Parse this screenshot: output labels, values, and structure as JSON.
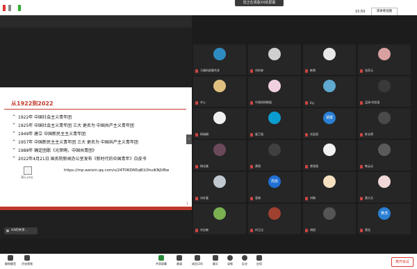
{
  "topbar": {
    "banner": "您正在观看XX的屏幕",
    "time": "15:50",
    "view_button": "演讲者视图"
  },
  "slide": {
    "title": "从1922到2022",
    "lines": [
      "1922年 中国社会主义青年团",
      "1925年 中国社会主义青年团 三大 更名为 中国共产主义青年团",
      "1949年 建立 中国新民主主义青年团",
      "1957年 中国新民主主义青年团 三大 更名为 中国共产主义青年团",
      "1988年 确定团歌《光荣啊，中国共青团》",
      "2022年4月21日 国务院新闻办公室发布《新时代的中国青年》白皮书"
    ],
    "url": "https://mp.weixin.qq.com/s/24T0RDN5qB1OhuiKNJVBw",
    "caption": "演示.png",
    "page": "1"
  },
  "share_label": "XX的共享...",
  "participants": [
    {
      "name": "马晴的屏幕共享",
      "color": "#2e8bc0",
      "text": ""
    },
    {
      "name": "刘怡婷",
      "color": "#cfcfcf",
      "text": ""
    },
    {
      "name": "韩雪",
      "color": "#e8e8e8",
      "text": ""
    },
    {
      "name": "张奇元",
      "color": "#d9a0a0",
      "text": ""
    },
    {
      "name": "齐心",
      "color": "#e0c080",
      "text": ""
    },
    {
      "name": "中国知网数据",
      "color": "#f0d0e0",
      "text": ""
    },
    {
      "name": "Ely",
      "color": "#5fa8d0",
      "text": ""
    },
    {
      "name": "孟绿·刘凯强",
      "color": "#3a3a3a",
      "text": ""
    },
    {
      "name": "杨瑞娟",
      "color": "#f0f0f0",
      "text": ""
    },
    {
      "name": "翟卫强",
      "color": "#0a9dd0",
      "text": ""
    },
    {
      "name": "任延斌",
      "color": "#2a7fd4",
      "text": "胡斌"
    },
    {
      "name": "陈长德",
      "color": "#4a4a4a",
      "text": ""
    },
    {
      "name": "杨佳美",
      "color": "#6a4a5a",
      "text": ""
    },
    {
      "name": "黄翔",
      "color": "#404040",
      "text": ""
    },
    {
      "name": "曾强强",
      "color": "#f2f2f2",
      "text": ""
    },
    {
      "name": "韩云洁",
      "color": "#5a5a5a",
      "text": ""
    },
    {
      "name": "刘轩嘉",
      "color": "#c0c8d0",
      "text": ""
    },
    {
      "name": "葛晓",
      "color": "#1f6fd6",
      "text": "周扬"
    },
    {
      "name": "刘畅",
      "color": "#f5e0c0",
      "text": ""
    },
    {
      "name": "黄大兵",
      "color": "#f0d8d8",
      "text": ""
    },
    {
      "name": "刘志敏",
      "color": "#7ab050",
      "text": ""
    },
    {
      "name": "何玉洁",
      "color": "#a04030",
      "text": ""
    },
    {
      "name": "胡斌",
      "color": "#555555",
      "text": ""
    },
    {
      "name": "黄浩",
      "color": "#2a7fd4",
      "text": "黄浩"
    }
  ],
  "toolbar": {
    "left": [
      "解除静音",
      "开启视频"
    ],
    "center": [
      "共享屏幕",
      "邀请",
      "成员(24)",
      "聊天",
      "录制",
      "反应",
      "应用"
    ],
    "leave": "离开会议"
  },
  "colors": {
    "accent": "#c0392b",
    "blue": "#2a7fd4"
  }
}
